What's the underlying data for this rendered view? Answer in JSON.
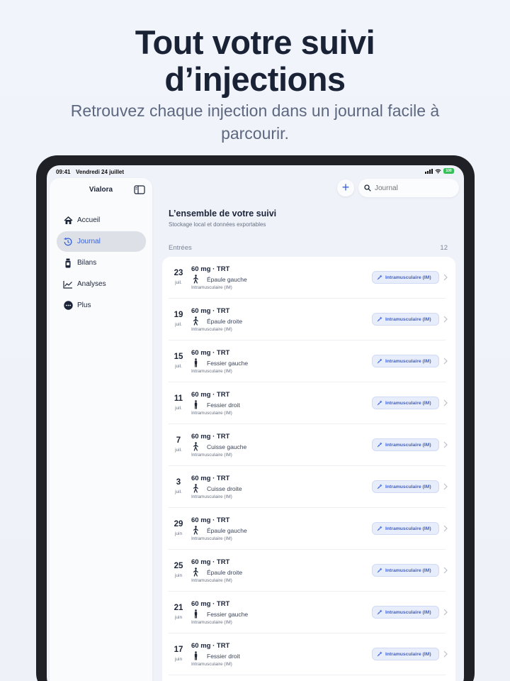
{
  "hero": {
    "title_line1": "Tout votre suivi",
    "title_line2": "d’injections",
    "subtitle": "Retrouvez chaque injection dans un journal facile à parcourir."
  },
  "status_bar": {
    "time": "09:41",
    "date": "Vendredi 24 juillet",
    "battery": "100"
  },
  "sidebar": {
    "app_title": "Vialora",
    "items": [
      {
        "label": "Accueil",
        "icon": "house-icon",
        "active": false
      },
      {
        "label": "Journal",
        "icon": "clock-history-icon",
        "active": true
      },
      {
        "label": "Bilans",
        "icon": "vial-icon",
        "active": false
      },
      {
        "label": "Analyses",
        "icon": "chart-line-icon",
        "active": false
      },
      {
        "label": "Plus",
        "icon": "ellipsis-circle-icon",
        "active": false
      }
    ]
  },
  "toolbar": {
    "search_placeholder": "Journal"
  },
  "content": {
    "title": "L’ensemble de votre suivi",
    "subtitle": "Stockage local et données exportables",
    "section_label": "Entrées",
    "section_count": "12"
  },
  "entries": [
    {
      "day": "23",
      "month": "juil.",
      "dose": "60 mg · TRT",
      "site": "Épaule gauche",
      "route": "Intramusculaire (IM)",
      "badge": "Intramusculaire (IM)",
      "figure": "walking-figure-icon"
    },
    {
      "day": "19",
      "month": "juil.",
      "dose": "60 mg · TRT",
      "site": "Épaule droite",
      "route": "Intramusculaire (IM)",
      "badge": "Intramusculaire (IM)",
      "figure": "walking-figure-icon"
    },
    {
      "day": "15",
      "month": "juil.",
      "dose": "60 mg · TRT",
      "site": "Fessier gauche",
      "route": "Intramusculaire (IM)",
      "badge": "Intramusculaire (IM)",
      "figure": "standing-figure-icon"
    },
    {
      "day": "11",
      "month": "juil.",
      "dose": "60 mg · TRT",
      "site": "Fessier droit",
      "route": "Intramusculaire (IM)",
      "badge": "Intramusculaire (IM)",
      "figure": "standing-figure-icon"
    },
    {
      "day": "7",
      "month": "juil.",
      "dose": "60 mg · TRT",
      "site": "Cuisse gauche",
      "route": "Intramusculaire (IM)",
      "badge": "Intramusculaire (IM)",
      "figure": "walking-figure-icon"
    },
    {
      "day": "3",
      "month": "juil.",
      "dose": "60 mg · TRT",
      "site": "Cuisse droite",
      "route": "Intramusculaire (IM)",
      "badge": "Intramusculaire (IM)",
      "figure": "walking-figure-icon"
    },
    {
      "day": "29",
      "month": "juin",
      "dose": "60 mg · TRT",
      "site": "Épaule gauche",
      "route": "Intramusculaire (IM)",
      "badge": "Intramusculaire (IM)",
      "figure": "walking-figure-icon"
    },
    {
      "day": "25",
      "month": "juin",
      "dose": "60 mg · TRT",
      "site": "Épaule droite",
      "route": "Intramusculaire (IM)",
      "badge": "Intramusculaire (IM)",
      "figure": "walking-figure-icon"
    },
    {
      "day": "21",
      "month": "juin",
      "dose": "60 mg · TRT",
      "site": "Fessier gauche",
      "route": "Intramusculaire (IM)",
      "badge": "Intramusculaire (IM)",
      "figure": "standing-figure-icon"
    },
    {
      "day": "17",
      "month": "juin",
      "dose": "60 mg · TRT",
      "site": "Fessier droit",
      "route": "Intramusculaire (IM)",
      "badge": "Intramusculaire (IM)",
      "figure": "standing-figure-icon"
    }
  ],
  "colors": {
    "accent": "#3a62d9",
    "badge_bg": "#e8edfb",
    "title": "#1a2236",
    "active_nav_bg": "#dde0e6"
  }
}
